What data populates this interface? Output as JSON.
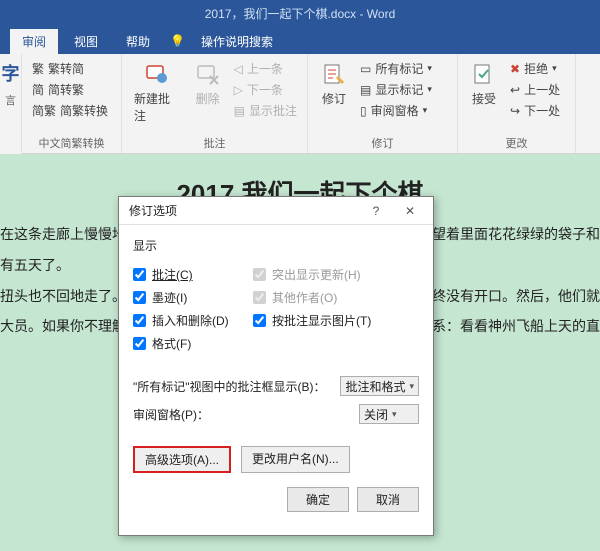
{
  "titlebar": "2017，我们一起下个棋.docx - Word",
  "tabs": {
    "review": "审阅",
    "view": "视图",
    "help": "帮助",
    "search": "操作说明搜索"
  },
  "leftedge": {
    "char": "字",
    "sub": "言"
  },
  "ribbon": {
    "simp": {
      "a": "繁转简",
      "b": "简转繁",
      "c": "简繁转换",
      "group": "中文简繁转换"
    },
    "comments": {
      "new": "新建批注",
      "del": "删除",
      "prev": "上一条",
      "next": "下一条",
      "show": "显示批注",
      "group": "批注"
    },
    "tracking": {
      "track": "修订",
      "all": "所有标记",
      "showmk": "显示标记",
      "pane": "审阅窗格",
      "group": "修订"
    },
    "changes": {
      "accept": "接受",
      "reject": "拒绝",
      "prev": "上一处",
      "next": "下一处",
      "group": "更改"
    }
  },
  "doc": {
    "heading": "2017  我们一起下个棋",
    "l1": "在这条走廊上慢慢地",
    "l1r": "斧望着里面花花绿绿的袋子和",
    "l2": "有五天了。",
    "l3": "扭头也不回地走了。",
    "l3r": "最终没有开口。然后，他们就",
    "l4": "大员。如果你不理解",
    "l4r": "关系：看看神州飞船上天的直"
  },
  "dialog": {
    "title": "修订选项",
    "display": "显示",
    "chk": {
      "comments": "批注(C)",
      "ink": "墨迹(I)",
      "insdel": "插入和删除(D)",
      "format": "格式(F)",
      "highlight": "突出显示更新(H)",
      "others": "其他作者(O)",
      "pictures": "按批注显示图片(T)"
    },
    "balloons_label": "\"所有标记\"视图中的批注框显示(B)：",
    "balloons_value": "批注和格式",
    "pane_label": "审阅窗格(P)：",
    "pane_value": "关闭",
    "advanced": "高级选项(A)...",
    "username": "更改用户名(N)...",
    "ok": "确定",
    "cancel": "取消"
  }
}
